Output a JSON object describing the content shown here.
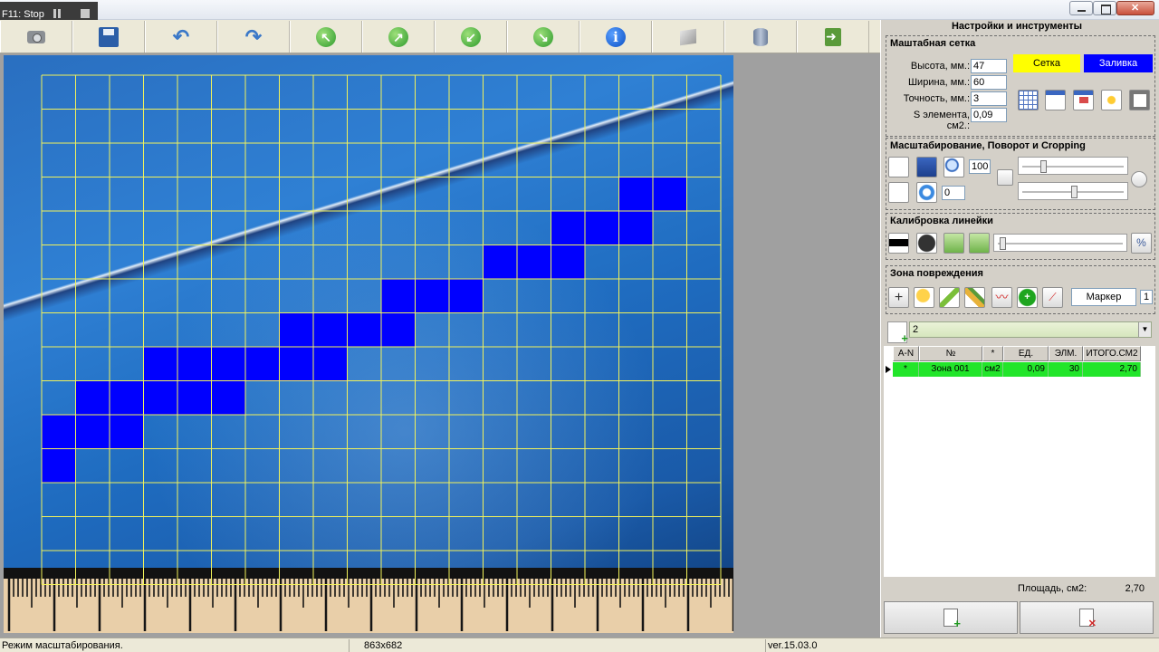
{
  "recorder": {
    "label": "F11: Stop"
  },
  "toolbar": {
    "buttons": [
      {
        "icon": "camera-icon"
      },
      {
        "icon": "save-icon"
      },
      {
        "icon": "undo-icon"
      },
      {
        "icon": "redo-icon"
      },
      {
        "icon": "arrow-up-left-icon"
      },
      {
        "icon": "arrow-up-right-icon"
      },
      {
        "icon": "arrow-down-left-icon"
      },
      {
        "icon": "arrow-down-right-icon"
      },
      {
        "icon": "info-icon"
      },
      {
        "icon": "box-icon"
      },
      {
        "icon": "database-icon"
      },
      {
        "icon": "exit-icon"
      }
    ]
  },
  "canvas": {
    "grid_color": "#f2f25a",
    "fill_color": "#0000ff",
    "grid_columns": 20,
    "grid_rows": 15,
    "filled_cells": [
      [
        17,
        3
      ],
      [
        18,
        3
      ],
      [
        15,
        4
      ],
      [
        16,
        4
      ],
      [
        17,
        4
      ],
      [
        13,
        5
      ],
      [
        14,
        5
      ],
      [
        15,
        5
      ],
      [
        10,
        6
      ],
      [
        11,
        6
      ],
      [
        12,
        6
      ],
      [
        7,
        7
      ],
      [
        8,
        7
      ],
      [
        9,
        7
      ],
      [
        10,
        7
      ],
      [
        3,
        8
      ],
      [
        4,
        8
      ],
      [
        5,
        8
      ],
      [
        6,
        8
      ],
      [
        7,
        8
      ],
      [
        8,
        8
      ],
      [
        1,
        9
      ],
      [
        2,
        9
      ],
      [
        3,
        9
      ],
      [
        4,
        9
      ],
      [
        5,
        9
      ],
      [
        0,
        10
      ],
      [
        1,
        10
      ],
      [
        2,
        10
      ],
      [
        0,
        11
      ]
    ]
  },
  "panel": {
    "title": "Настройки и инструменты",
    "scale_grid": {
      "title": "Маштабная сетка",
      "height_label": "Высота, мм.:",
      "height_value": "47",
      "width_label": "Ширина, мм.:",
      "width_value": "60",
      "precision_label": "Точность, мм.:",
      "precision_value": "3",
      "element_label": "S элемента, см2.:",
      "element_value": "0,09",
      "grid_toggle": "Сетка",
      "fill_toggle": "Заливка",
      "grid_toggle_color": "#ffff00",
      "fill_toggle_color": "#0000ff"
    },
    "scaling": {
      "title": "Масштабирование, Поворот и Cropping",
      "zoom_value": "100",
      "rotate_value": "0"
    },
    "calibration": {
      "title": "Калибровка линейки"
    },
    "damage_zone": {
      "title": "Зона повреждения",
      "marker_label": "Маркер",
      "marker_value": "1"
    },
    "zone_select_value": "2",
    "table": {
      "headers": [
        "A-N",
        "№",
        "*",
        "ЕД.",
        "ЭЛМ.",
        "ИТОГО.СМ2"
      ],
      "rows": [
        [
          "*",
          "Зона 001",
          "см2",
          "0,09",
          "30",
          "2,70"
        ]
      ],
      "row_color": "#22e52a"
    },
    "area_label": "Площадь, см2:",
    "area_value": "2,70"
  },
  "status": {
    "mode": "Режим масштабирования.",
    "size": "863x682",
    "version": "ver.15.03.0"
  }
}
